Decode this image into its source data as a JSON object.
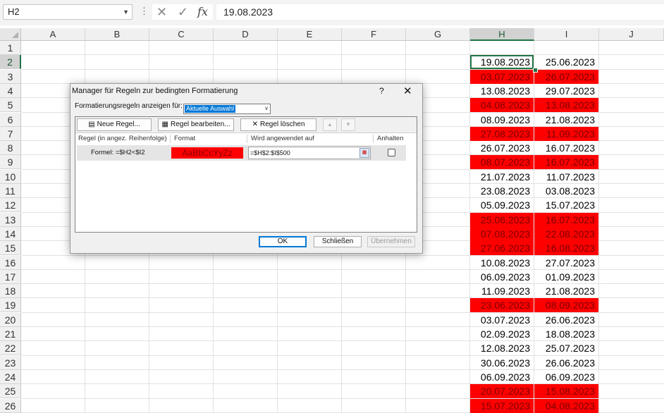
{
  "formula_bar": {
    "name_box": "H2",
    "dots": "⋮",
    "cancel": "✕",
    "confirm": "✓",
    "fx": "fx",
    "formula": "19.08.2023"
  },
  "columns": [
    "A",
    "B",
    "C",
    "D",
    "E",
    "F",
    "G",
    "H",
    "I",
    "J"
  ],
  "selected_column": "H",
  "rows": [
    "1",
    "2",
    "3",
    "4",
    "5",
    "6",
    "7",
    "8",
    "9",
    "10",
    "11",
    "12",
    "13",
    "14",
    "15",
    "16",
    "17",
    "18",
    "19",
    "20",
    "21",
    "22",
    "23",
    "24",
    "25",
    "26"
  ],
  "active_cell": "H2",
  "highlight_color": "#ff0000",
  "data": [
    {
      "h": "19.08.2023",
      "i": "25.06.2023",
      "red": false
    },
    {
      "h": "03.07.2023",
      "i": "26.07.2023",
      "red": true
    },
    {
      "h": "13.08.2023",
      "i": "29.07.2023",
      "red": false
    },
    {
      "h": "04.08.2023",
      "i": "13.08.2023",
      "red": true
    },
    {
      "h": "08.09.2023",
      "i": "21.08.2023",
      "red": false
    },
    {
      "h": "27.08.2023",
      "i": "11.09.2023",
      "red": true
    },
    {
      "h": "26.07.2023",
      "i": "16.07.2023",
      "red": false
    },
    {
      "h": "08.07.2023",
      "i": "16.07.2023",
      "red": true
    },
    {
      "h": "21.07.2023",
      "i": "11.07.2023",
      "red": false
    },
    {
      "h": "23.08.2023",
      "i": "03.08.2023",
      "red": false
    },
    {
      "h": "05.09.2023",
      "i": "15.07.2023",
      "red": false
    },
    {
      "h": "25.06.2023",
      "i": "16.07.2023",
      "red": true
    },
    {
      "h": "07.08.2023",
      "i": "22.08.2023",
      "red": true
    },
    {
      "h": "27.06.2023",
      "i": "16.08.2023",
      "red": true
    },
    {
      "h": "10.08.2023",
      "i": "27.07.2023",
      "red": false
    },
    {
      "h": "06.09.2023",
      "i": "01.09.2023",
      "red": false
    },
    {
      "h": "11.09.2023",
      "i": "21.08.2023",
      "red": false
    },
    {
      "h": "23.06.2023",
      "i": "08.09.2023",
      "red": true
    },
    {
      "h": "03.07.2023",
      "i": "26.06.2023",
      "red": false
    },
    {
      "h": "02.09.2023",
      "i": "18.08.2023",
      "red": false
    },
    {
      "h": "12.08.2023",
      "i": "25.07.2023",
      "red": false
    },
    {
      "h": "30.06.2023",
      "i": "26.06.2023",
      "red": false
    },
    {
      "h": "06.09.2023",
      "i": "06.09.2023",
      "red": false
    },
    {
      "h": "20.07.2023",
      "i": "15.08.2023",
      "red": true
    },
    {
      "h": "15.07.2023",
      "i": "04.08.2023",
      "red": true
    }
  ],
  "dialog": {
    "title": "Manager für Regeln zur bedingten Formatierung",
    "help": "?",
    "close": "✕",
    "show_rules_label": "Formatierungsregeln anzeigen für:",
    "show_rules_value": "Aktuelle Auswahl",
    "buttons": {
      "new_rule": "Neue Regel...",
      "edit_rule": "Regel bearbeiten...",
      "delete_rule": "Regel löschen",
      "move_up": "▲",
      "move_down": "▼"
    },
    "headers": {
      "rule": "Regel (in angez. Reihenfolge)",
      "format": "Format",
      "applies_to": "Wird angewendet auf",
      "stop": "Anhalten"
    },
    "rule": {
      "name": "Formel: =$H2<$I2",
      "preview": "AaBbCcYyZz",
      "applies_to": "=$H$2:$I$500",
      "stop_if_true": false
    },
    "ok": "OK",
    "close_button": "Schließen",
    "apply": "Übernehmen"
  }
}
